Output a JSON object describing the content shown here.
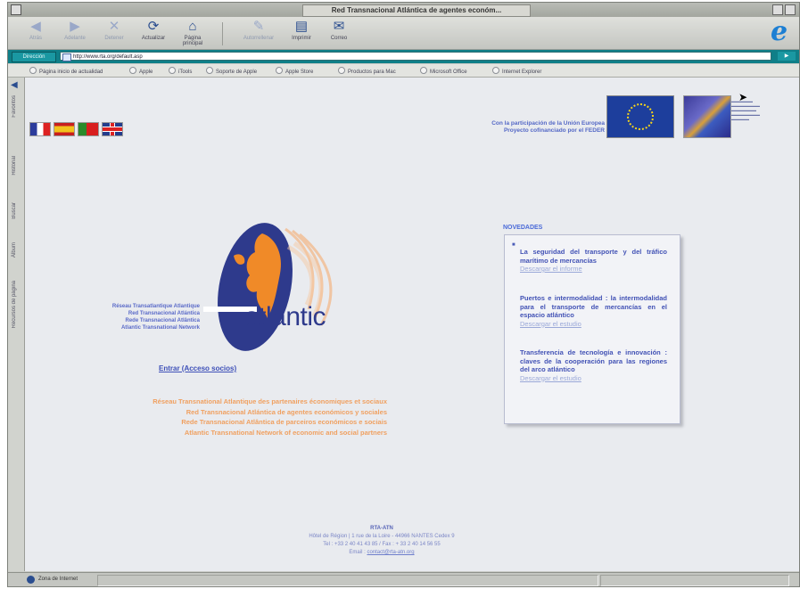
{
  "window": {
    "title": "Red Transnacional Atlántica de agentes económ..."
  },
  "toolbar": {
    "back": "Atrás",
    "forward": "Adelante",
    "stop": "Detener",
    "refresh": "Actualizar",
    "home": "Página principal",
    "autofill": "Autorrellenar",
    "print": "Imprimir",
    "mail": "Correo"
  },
  "address": {
    "label": "Dirección",
    "url": "http://www.rta.org/default.asp"
  },
  "links": [
    "Página inicio de actualidad",
    "Apple",
    "iTools",
    "Soporte de Apple",
    "Apple Store",
    "Productos para Mac",
    "Microsoft Office",
    "Internet Explorer"
  ],
  "explorer_tabs": [
    "Favoritos",
    "Historial",
    "Buscar",
    "Álbum",
    "Recursos de página"
  ],
  "page": {
    "eu_text_line1": "Con la participación de la Unión Europea",
    "eu_text_line2": "Proyecto cofinanciado por el FEDER",
    "logo_word": "atlantic",
    "network_names": [
      "Réseau Transatlantique Atlantique",
      "Red Transnacional Atlántica",
      "Rede Transnacional Atlântica",
      "Atlantic Transnational Network"
    ],
    "enter_link": "Entrar (Acceso socios)",
    "orange_titles": [
      "Réseau Transnational Atlantique des partenaires économiques et sociaux",
      "Red Transnacional Atlántica de agentes económicos y sociales",
      "Rede Transnacional Atlântica de parceiros económicos e sociais",
      "Atlantic Transnational Network of economic and social partners"
    ],
    "news_title": "NOVEDADES",
    "news": [
      {
        "title": "La seguridad del transporte y del tráfico marítimo de mercancías",
        "link": "Descargar el informe"
      },
      {
        "title": "Puertos e intermodalidad : la intermodalidad para el transporte de mercancías en el espacio atlántico",
        "link": "Descargar el estudio"
      },
      {
        "title": "Transferencia de tecnología e innovación : claves de la cooperación para las regiones del arco atlántico",
        "link": "Descargar el estudio"
      }
    ],
    "footer": {
      "org": "RTA-ATN",
      "address": "Hôtel de Région | 1 rue de la Loire - 44966 NANTES Cedex 9",
      "phone": "Tel : +33 2 40 41 43 85 / Fax : + 33 2 40 14 56 55",
      "email_label": "Email : ",
      "email": "contact@rta-atn.org"
    }
  },
  "status": {
    "text": "Zona de Internet"
  },
  "colors": {
    "logo_blue": "#2e3a8c",
    "logo_orange": "#f08a28",
    "link_blue": "#4252b5",
    "address_teal": "#0f7f88"
  }
}
